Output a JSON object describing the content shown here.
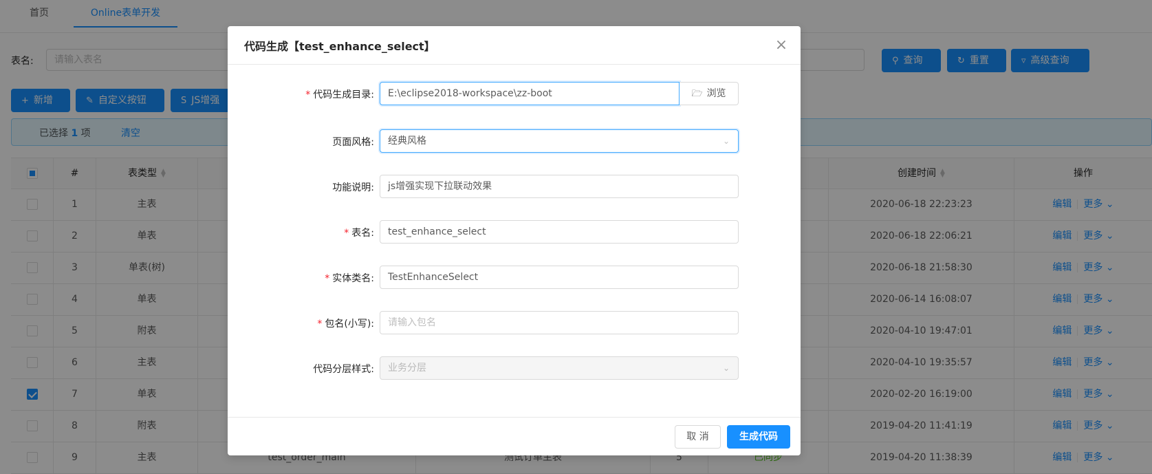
{
  "tabs": [
    {
      "label": "首页"
    },
    {
      "label": "Online表单开发"
    }
  ],
  "search": {
    "label": "表名:",
    "placeholder": "请输入表名",
    "query_label": "查询",
    "reset_label": "重置",
    "advanced_label": "高级查询"
  },
  "toolbar": {
    "add_label": "新增",
    "custom_label": "自定义按钮",
    "js_label": "JS增强"
  },
  "selection": {
    "prefix": "已选择",
    "count": "1",
    "suffix": "项",
    "clear_label": "清空"
  },
  "table": {
    "headers": {
      "num": "#",
      "type": "表类型",
      "time": "创建时间",
      "op": "操作"
    },
    "rows": [
      {
        "num": "1",
        "type": "主表",
        "time": "2020-06-18 22:23:23",
        "checked": false
      },
      {
        "num": "2",
        "type": "单表",
        "time": "2020-06-18 22:06:21",
        "checked": false
      },
      {
        "num": "3",
        "type": "单表(树)",
        "time": "2020-06-18 21:58:30",
        "checked": false
      },
      {
        "num": "4",
        "type": "单表",
        "time": "2020-06-14 16:08:07",
        "checked": false
      },
      {
        "num": "5",
        "type": "附表",
        "time": "2020-04-10 19:47:01",
        "checked": false
      },
      {
        "num": "6",
        "type": "主表",
        "time": "2020-04-10 19:35:57",
        "checked": false
      },
      {
        "num": "7",
        "type": "单表",
        "time": "2020-02-20 16:19:00",
        "checked": true
      },
      {
        "num": "8",
        "type": "附表",
        "time": "2019-04-20 11:41:19",
        "checked": false
      },
      {
        "num": "9",
        "type": "主表",
        "name": "test_order_main",
        "desc": "测试订单主表",
        "ver": "5",
        "sync": "已同步",
        "time": "2019-04-20 11:38:39",
        "checked": false
      }
    ],
    "edit_label": "编辑",
    "more_label": "更多"
  },
  "modal": {
    "title": "代码生成【test_enhance_select】",
    "fields": {
      "dir": {
        "label": "代码生成目录:",
        "value": "E:\\eclipse2018-workspace\\zz-boot",
        "browse_label": "浏览",
        "required": true
      },
      "style": {
        "label": "页面风格:",
        "value": "经典风格",
        "required": false
      },
      "desc": {
        "label": "功能说明:",
        "value": "js增强实现下拉联动效果",
        "required": false
      },
      "table": {
        "label": "表名:",
        "value": "test_enhance_select",
        "required": true
      },
      "entity": {
        "label": "实体类名:",
        "value": "TestEnhanceSelect",
        "required": true
      },
      "package": {
        "label": "包名(小写):",
        "placeholder": "请输入包名",
        "required": true
      },
      "layer": {
        "label": "代码分层样式:",
        "value": "业务分层",
        "required": false
      }
    },
    "cancel_label": "取 消",
    "ok_label": "生成代码"
  },
  "colors": {
    "primary": "#1890ff",
    "required": "#f5222d",
    "success": "#52c41a"
  }
}
